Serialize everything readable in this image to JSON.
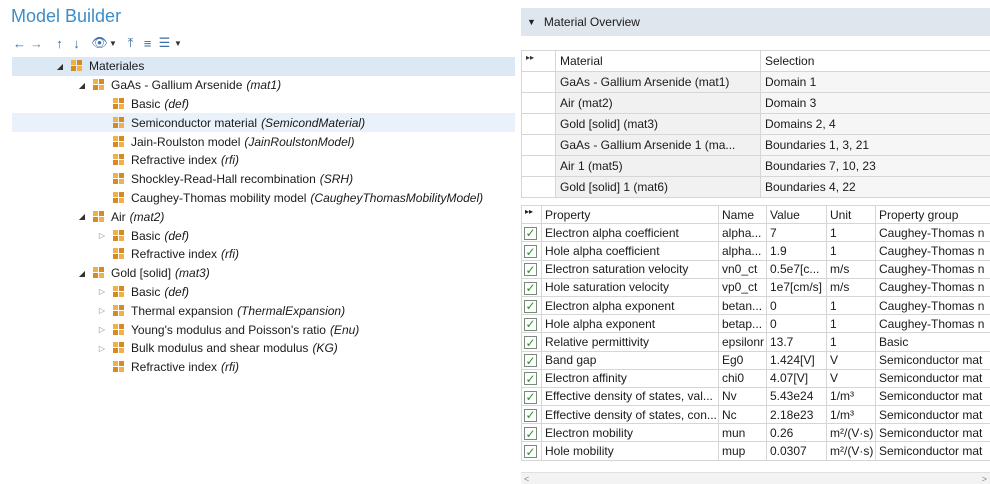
{
  "model_builder": {
    "title": "Model Builder",
    "toolbar": [
      {
        "icon": "arrow-left-icon",
        "glyph": "←"
      },
      {
        "icon": "arrow-right-icon",
        "glyph": "→"
      },
      {
        "icon": "arrow-up-icon",
        "glyph": "↑"
      },
      {
        "icon": "arrow-down-icon",
        "glyph": "↓"
      },
      {
        "icon": "show-icon",
        "glyph": "👁"
      },
      {
        "icon": "collapse-all-icon",
        "glyph": "⤒"
      },
      {
        "icon": "expand-all-icon",
        "glyph": "≡"
      },
      {
        "icon": "list-icon",
        "glyph": "☰"
      }
    ],
    "tree": [
      {
        "level": 0,
        "expander": "open",
        "label": "Materiales",
        "tag": "",
        "state": "selected"
      },
      {
        "level": 1,
        "expander": "open",
        "label": "GaAs - Gallium Arsenide",
        "tag": "(mat1)",
        "state": ""
      },
      {
        "level": 2,
        "expander": "none",
        "label": "Basic",
        "tag": "(def)",
        "state": ""
      },
      {
        "level": 2,
        "expander": "none",
        "label": "Semiconductor material",
        "tag": "(SemicondMaterial)",
        "state": "hover"
      },
      {
        "level": 2,
        "expander": "none",
        "label": "Jain-Roulston model",
        "tag": "(JainRoulstonModel)",
        "state": ""
      },
      {
        "level": 2,
        "expander": "none",
        "label": "Refractive index",
        "tag": "(rfi)",
        "state": ""
      },
      {
        "level": 2,
        "expander": "none",
        "label": "Shockley-Read-Hall recombination",
        "tag": "(SRH)",
        "state": ""
      },
      {
        "level": 2,
        "expander": "none",
        "label": "Caughey-Thomas mobility model",
        "tag": "(CaugheyThomasMobilityModel)",
        "state": ""
      },
      {
        "level": 1,
        "expander": "open",
        "label": "Air",
        "tag": "(mat2)",
        "state": ""
      },
      {
        "level": 2,
        "expander": "closed",
        "label": "Basic",
        "tag": "(def)",
        "state": ""
      },
      {
        "level": 2,
        "expander": "none",
        "label": "Refractive index",
        "tag": "(rfi)",
        "state": ""
      },
      {
        "level": 1,
        "expander": "open",
        "label": "Gold [solid]",
        "tag": "(mat3)",
        "state": ""
      },
      {
        "level": 2,
        "expander": "closed",
        "label": "Basic",
        "tag": "(def)",
        "state": ""
      },
      {
        "level": 2,
        "expander": "closed",
        "label": "Thermal expansion",
        "tag": "(ThermalExpansion)",
        "state": ""
      },
      {
        "level": 2,
        "expander": "closed",
        "label": "Young's modulus and Poisson's ratio",
        "tag": "(Enu)",
        "state": ""
      },
      {
        "level": 2,
        "expander": "closed",
        "label": "Bulk modulus and shear modulus",
        "tag": "(KG)",
        "state": ""
      },
      {
        "level": 2,
        "expander": "none",
        "label": "Refractive index",
        "tag": "(rfi)",
        "state": ""
      }
    ]
  },
  "material_overview": {
    "title": "Material Overview",
    "selection_table": {
      "corner": "▸▸",
      "headers": [
        "Material",
        "Selection"
      ],
      "rows": [
        [
          "GaAs - Gallium Arsenide (mat1)",
          "Domain   1"
        ],
        [
          "Air (mat2)",
          "Domain   3"
        ],
        [
          "Gold [solid] (mat3)",
          "Domains   2, 4"
        ],
        [
          "GaAs - Gallium Arsenide 1 (ma...",
          "Boundaries  1, 3, 21"
        ],
        [
          "Air 1 (mat5)",
          "Boundaries  7, 10, 23"
        ],
        [
          "Gold [solid] 1 (mat6)",
          "Boundaries  4, 22"
        ]
      ]
    },
    "property_table": {
      "corner": "▸▸",
      "headers": [
        "Property",
        "Name",
        "Value",
        "Unit",
        "Property group"
      ],
      "rows": [
        [
          "Electron alpha coefficient",
          "alpha...",
          "7",
          "1",
          "Caughey-Thomas n"
        ],
        [
          "Hole alpha coefficient",
          "alpha...",
          "1.9",
          "1",
          "Caughey-Thomas n"
        ],
        [
          "Electron saturation velocity",
          "vn0_ct",
          "0.5e7[c...",
          "m/s",
          "Caughey-Thomas n"
        ],
        [
          "Hole saturation velocity",
          "vp0_ct",
          "1e7[cm/s]",
          "m/s",
          "Caughey-Thomas n"
        ],
        [
          "Electron alpha exponent",
          "betan...",
          "0",
          "1",
          "Caughey-Thomas n"
        ],
        [
          "Hole alpha exponent",
          "betap...",
          "0",
          "1",
          "Caughey-Thomas n"
        ],
        [
          "Relative permittivity",
          "epsilonr",
          "13.7",
          "1",
          "Basic"
        ],
        [
          "Band gap",
          "Eg0",
          "1.424[V]",
          "V",
          "Semiconductor mat"
        ],
        [
          "Electron affinity",
          "chi0",
          "4.07[V]",
          "V",
          "Semiconductor mat"
        ],
        [
          "Effective density of states, val...",
          "Nv",
          "5.43e24",
          "1/m³",
          "Semiconductor mat"
        ],
        [
          "Effective density of states, con...",
          "Nc",
          "2.18e23",
          "1/m³",
          "Semiconductor mat"
        ],
        [
          "Electron mobility",
          "mun",
          "0.26",
          "m²/(V·s)",
          "Semiconductor mat"
        ],
        [
          "Hole mobility",
          "mup",
          "0.0307",
          "m²/(V·s)",
          "Semiconductor mat"
        ]
      ]
    },
    "colors": {
      "header_bg": "#dfe6ee",
      "title_blue": "#3c8dc9",
      "check_green": "#2f8c2f",
      "selected_row": "#dde8f5"
    }
  }
}
